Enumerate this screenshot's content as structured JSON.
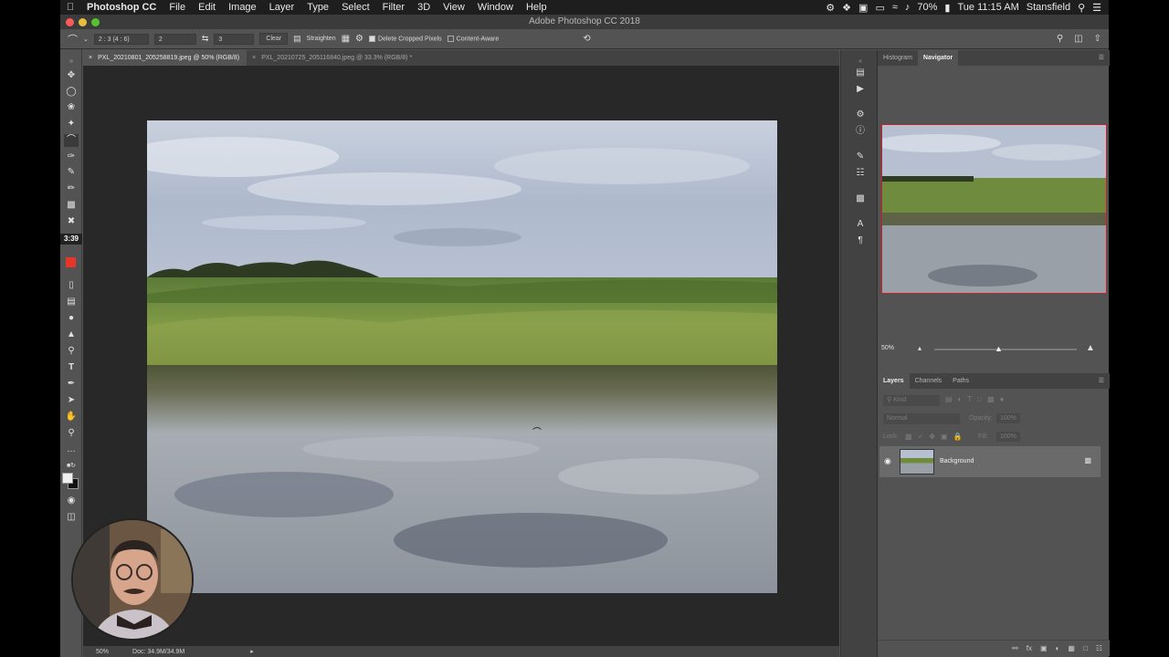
{
  "menubar": {
    "app_name": "Photoshop CC",
    "items": [
      "File",
      "Edit",
      "Image",
      "Layer",
      "Type",
      "Select",
      "Filter",
      "3D",
      "View",
      "Window",
      "Help"
    ],
    "battery": "70%",
    "clock": "Tue 11:15 AM",
    "user": "Stansfield"
  },
  "window": {
    "title": "Adobe Photoshop CC 2018"
  },
  "options": {
    "ratio_preset": "2 : 3 (4 : 6)",
    "width_value": "2",
    "height_value": "3",
    "clear_label": "Clear",
    "straighten_label": "Straighten",
    "delete_cropped_label": "Delete Cropped Pixels",
    "content_aware_label": "Content-Aware"
  },
  "toolbar": {
    "timer": "3:39"
  },
  "tabs": [
    {
      "label": "PXL_20210801_205258819.jpeg @ 50% (RGB/8)"
    },
    {
      "label": "PXL_20210725_205116840.jpeg @ 33.3% (RGB/8) *"
    }
  ],
  "status": {
    "zoom": "50%",
    "doc": "Doc: 34.9M/34.9M"
  },
  "panels": {
    "top_tabs": [
      "Histogram",
      "Navigator"
    ],
    "nav_zoom": "50%",
    "layer_tabs": [
      "Layers",
      "Channels",
      "Paths"
    ],
    "kind_placeholder": "Kind",
    "blend_mode": "Normal",
    "opacity_label": "Opacity:",
    "opacity_value": "100%",
    "lock_label": "Lock:",
    "fill_label": "Fill:",
    "fill_value": "100%",
    "layer_name": "Background"
  },
  "colors": {
    "foreground": "#e8352a",
    "accent_border": "#c8202a"
  }
}
